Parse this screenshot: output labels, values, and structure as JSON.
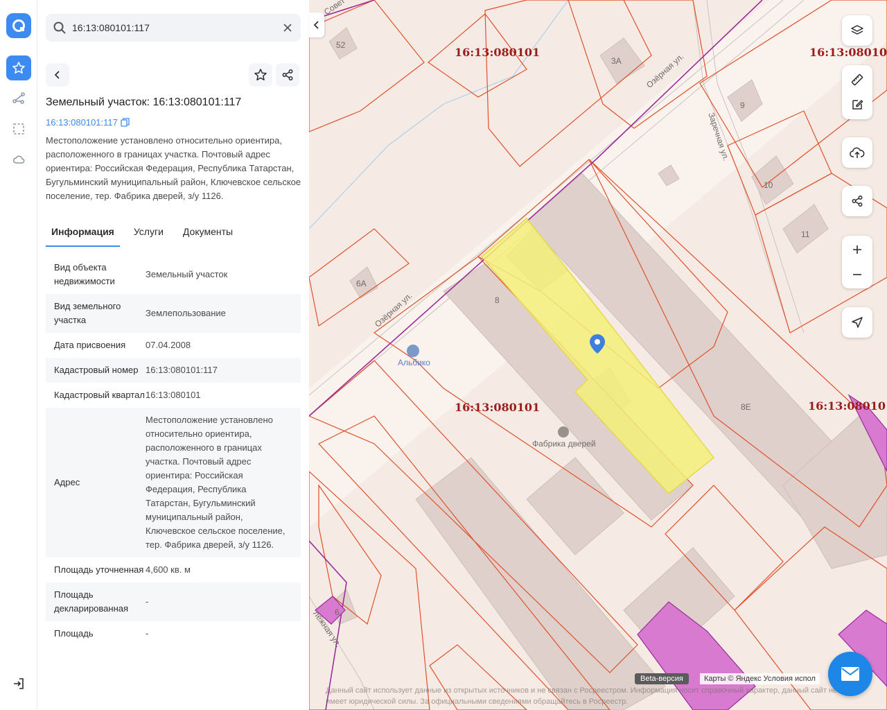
{
  "search": {
    "value": "16:13:080101:117"
  },
  "object": {
    "title": "Земельный участок: 16:13:080101:117",
    "cad_link": "16:13:080101:117",
    "description": "Местоположение установлено относительно ориентира, расположенного в границах участка. Почтовый адрес ориентира: Российская Федерация, Республика Татарстан, Бугульминский муниципальный район, Ключевское сельское поселение, тер. Фабрика дверей, з/у 1126."
  },
  "tabs": [
    {
      "label": "Информация"
    },
    {
      "label": "Услуги"
    },
    {
      "label": "Документы"
    }
  ],
  "info_rows": [
    {
      "key": "Вид объекта недвижимости",
      "value": "Земельный участок"
    },
    {
      "key": "Вид земельного участка",
      "value": "Землепользование"
    },
    {
      "key": "Дата присвоения",
      "value": "07.04.2008"
    },
    {
      "key": "Кадастровый номер",
      "value": "16:13:080101:117"
    },
    {
      "key": "Кадастровый квартал",
      "value": "16:13:080101"
    },
    {
      "key": "Адрес",
      "value": "Местоположение установлено относительно ориентира, расположенного в границах участка. Почтовый адрес ориентира: Российская Федерация, Республика Татарстан, Бугульминский муниципальный район, Ключевское сельское поселение, тер. Фабрика дверей, з/у 1126."
    },
    {
      "key": "Площадь уточненная",
      "value": "4,600 кв. м"
    },
    {
      "key": "Площадь декларированная",
      "value": "-"
    },
    {
      "key": "Площадь",
      "value": "-"
    }
  ],
  "map": {
    "quarter_labels": [
      "16:13:080101",
      "16:13:080101",
      "16:13:08010",
      "16:13:08010"
    ],
    "street_labels": [
      "Озёрная ул.",
      "Озёрная ул.",
      "Заречная ул.",
      "Совет",
      "лежная ул."
    ],
    "house_numbers": [
      "52",
      "3А",
      "9",
      "10",
      "11",
      "6А",
      "8",
      "8Е",
      "6"
    ],
    "pois": [
      "Альбико",
      "Фабрика дверей"
    ],
    "beta": "Beta-версия",
    "attribution": "Карты © Яндекс   Условия испол",
    "disclaimer": "Данный сайт использует данные из открытых источников и не связан с Росреестром. Информация носит справочный характер, данный сайт не имеет юридической силы. За официальными сведениями обращайтесь в Росреестр."
  },
  "colors": {
    "accent": "#3d8bf0",
    "parcel_border": "#e0502a",
    "selected_fill": "#f5f07a",
    "quarter_text": "#9b1c1c",
    "purple": "#9c2b9c"
  }
}
